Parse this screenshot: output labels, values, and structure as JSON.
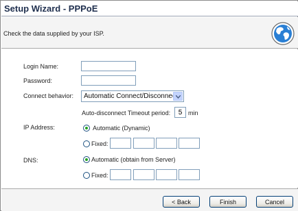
{
  "window": {
    "title": "Setup Wizard - PPPoE"
  },
  "header": {
    "instructions": "Check the data supplied by your ISP."
  },
  "form": {
    "login_name": {
      "label": "Login Name:",
      "value": ""
    },
    "password": {
      "label": "Password:",
      "value": ""
    },
    "connect_behavior": {
      "label": "Connect behavior:",
      "selected": "Automatic Connect/Disconnect"
    },
    "timeout": {
      "label": "Auto-disconnect Timeout period:",
      "value": "5",
      "unit": "min"
    },
    "ip_address": {
      "label": "IP Address:",
      "automatic_label": "Automatic (Dynamic)",
      "fixed_label": "Fixed:",
      "selected": "automatic"
    },
    "dns": {
      "label": "DNS:",
      "automatic_label": "Automatic (obtain from Server)",
      "fixed_label": "Fixed:",
      "selected": "automatic"
    }
  },
  "buttons": {
    "back": "< Back",
    "finish": "Finish",
    "cancel": "Cancel"
  },
  "colors": {
    "title": "#1f2f4e",
    "band": "#f4f4f4",
    "radio_dot": "#21a121",
    "input_border": "#7f9db9"
  },
  "icons": {
    "header": "globe-icon",
    "dropdown": "chevron-down-icon"
  }
}
